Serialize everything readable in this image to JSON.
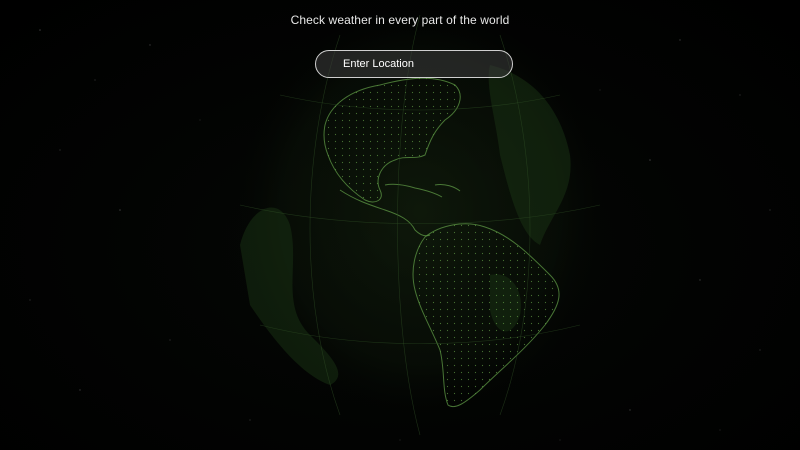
{
  "page": {
    "headline": "Check weather in every part of the world"
  },
  "search": {
    "placeholder": "Enter Location",
    "value": ""
  },
  "globe": {
    "line_color": "#5f9a45",
    "glow_color": "#1f3a17",
    "background": "#000000"
  }
}
